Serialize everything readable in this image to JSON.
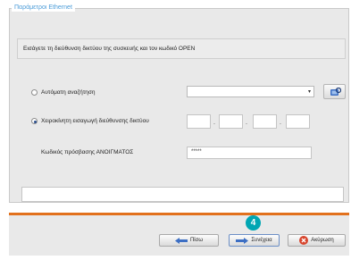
{
  "dialog": {
    "group_title": "Παράμετροι Ethernet",
    "description": "Εισάγετε τη διεύθυνση δικτύου της συσκευής και τον κωδικό OPEN"
  },
  "options": {
    "auto_search_label": "Αυτόματη αναζήτηση",
    "manual_ip_label": "Χειροκίνητη εισαγωγή διεύθυνσης δικτύου",
    "selected": "manual_ip"
  },
  "auto_search": {
    "combo_value": "",
    "search_icon": "search-device-icon"
  },
  "manual_ip": {
    "octets": [
      "",
      "",
      "",
      ""
    ]
  },
  "password": {
    "label": "Κωδικός πρόσβασης ΑΝΟΙΓΜΑΤΟΣ",
    "value": "*****"
  },
  "status": {
    "text": ""
  },
  "footer": {
    "back_label": "Πίσω",
    "next_label": "Συνέχεια",
    "cancel_label": "Ακύρωση",
    "step_badge": "4"
  },
  "colors": {
    "accent_title": "#4a9bd8",
    "separator": "#e2711d",
    "badge": "#00a6b3",
    "cancel_icon": "#d7452d",
    "arrow_icon": "#3d6fc4"
  }
}
